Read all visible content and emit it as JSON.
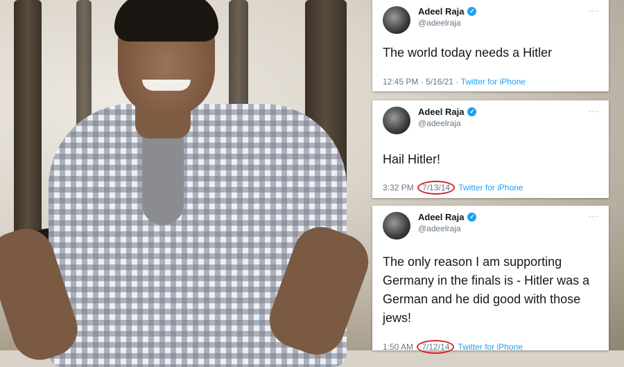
{
  "tweets": [
    {
      "name": "Adeel Raja",
      "handle": "@adeelraja",
      "text": "The world today needs a Hitler",
      "time": "12:45 PM",
      "separator": "·",
      "date": "5/16/21",
      "source_sep": "·",
      "source": "Twitter for iPhone",
      "date_circled": false
    },
    {
      "name": "Adeel Raja",
      "handle": "@adeelraja",
      "text": "Hail Hitler!",
      "time": "3:32 PM",
      "separator": "",
      "date": "7/13/14",
      "source_sep": "",
      "source": "Twitter for iPhone",
      "date_circled": true
    },
    {
      "name": "Adeel Raja",
      "handle": "@adeelraja",
      "text": "The only reason I am supporting Germany in the finals is - Hitler was a German and he did good with those jews!",
      "time": "1:50 AM",
      "separator": "",
      "date": "7/12/14",
      "source_sep": "",
      "source": "Twitter for iPhone",
      "date_circled": true
    }
  ],
  "more_icon": "···",
  "verified_icon": "check-badge",
  "colors": {
    "link": "#1da1f2",
    "circle": "#d4242a",
    "verified": "#1da1f2"
  }
}
